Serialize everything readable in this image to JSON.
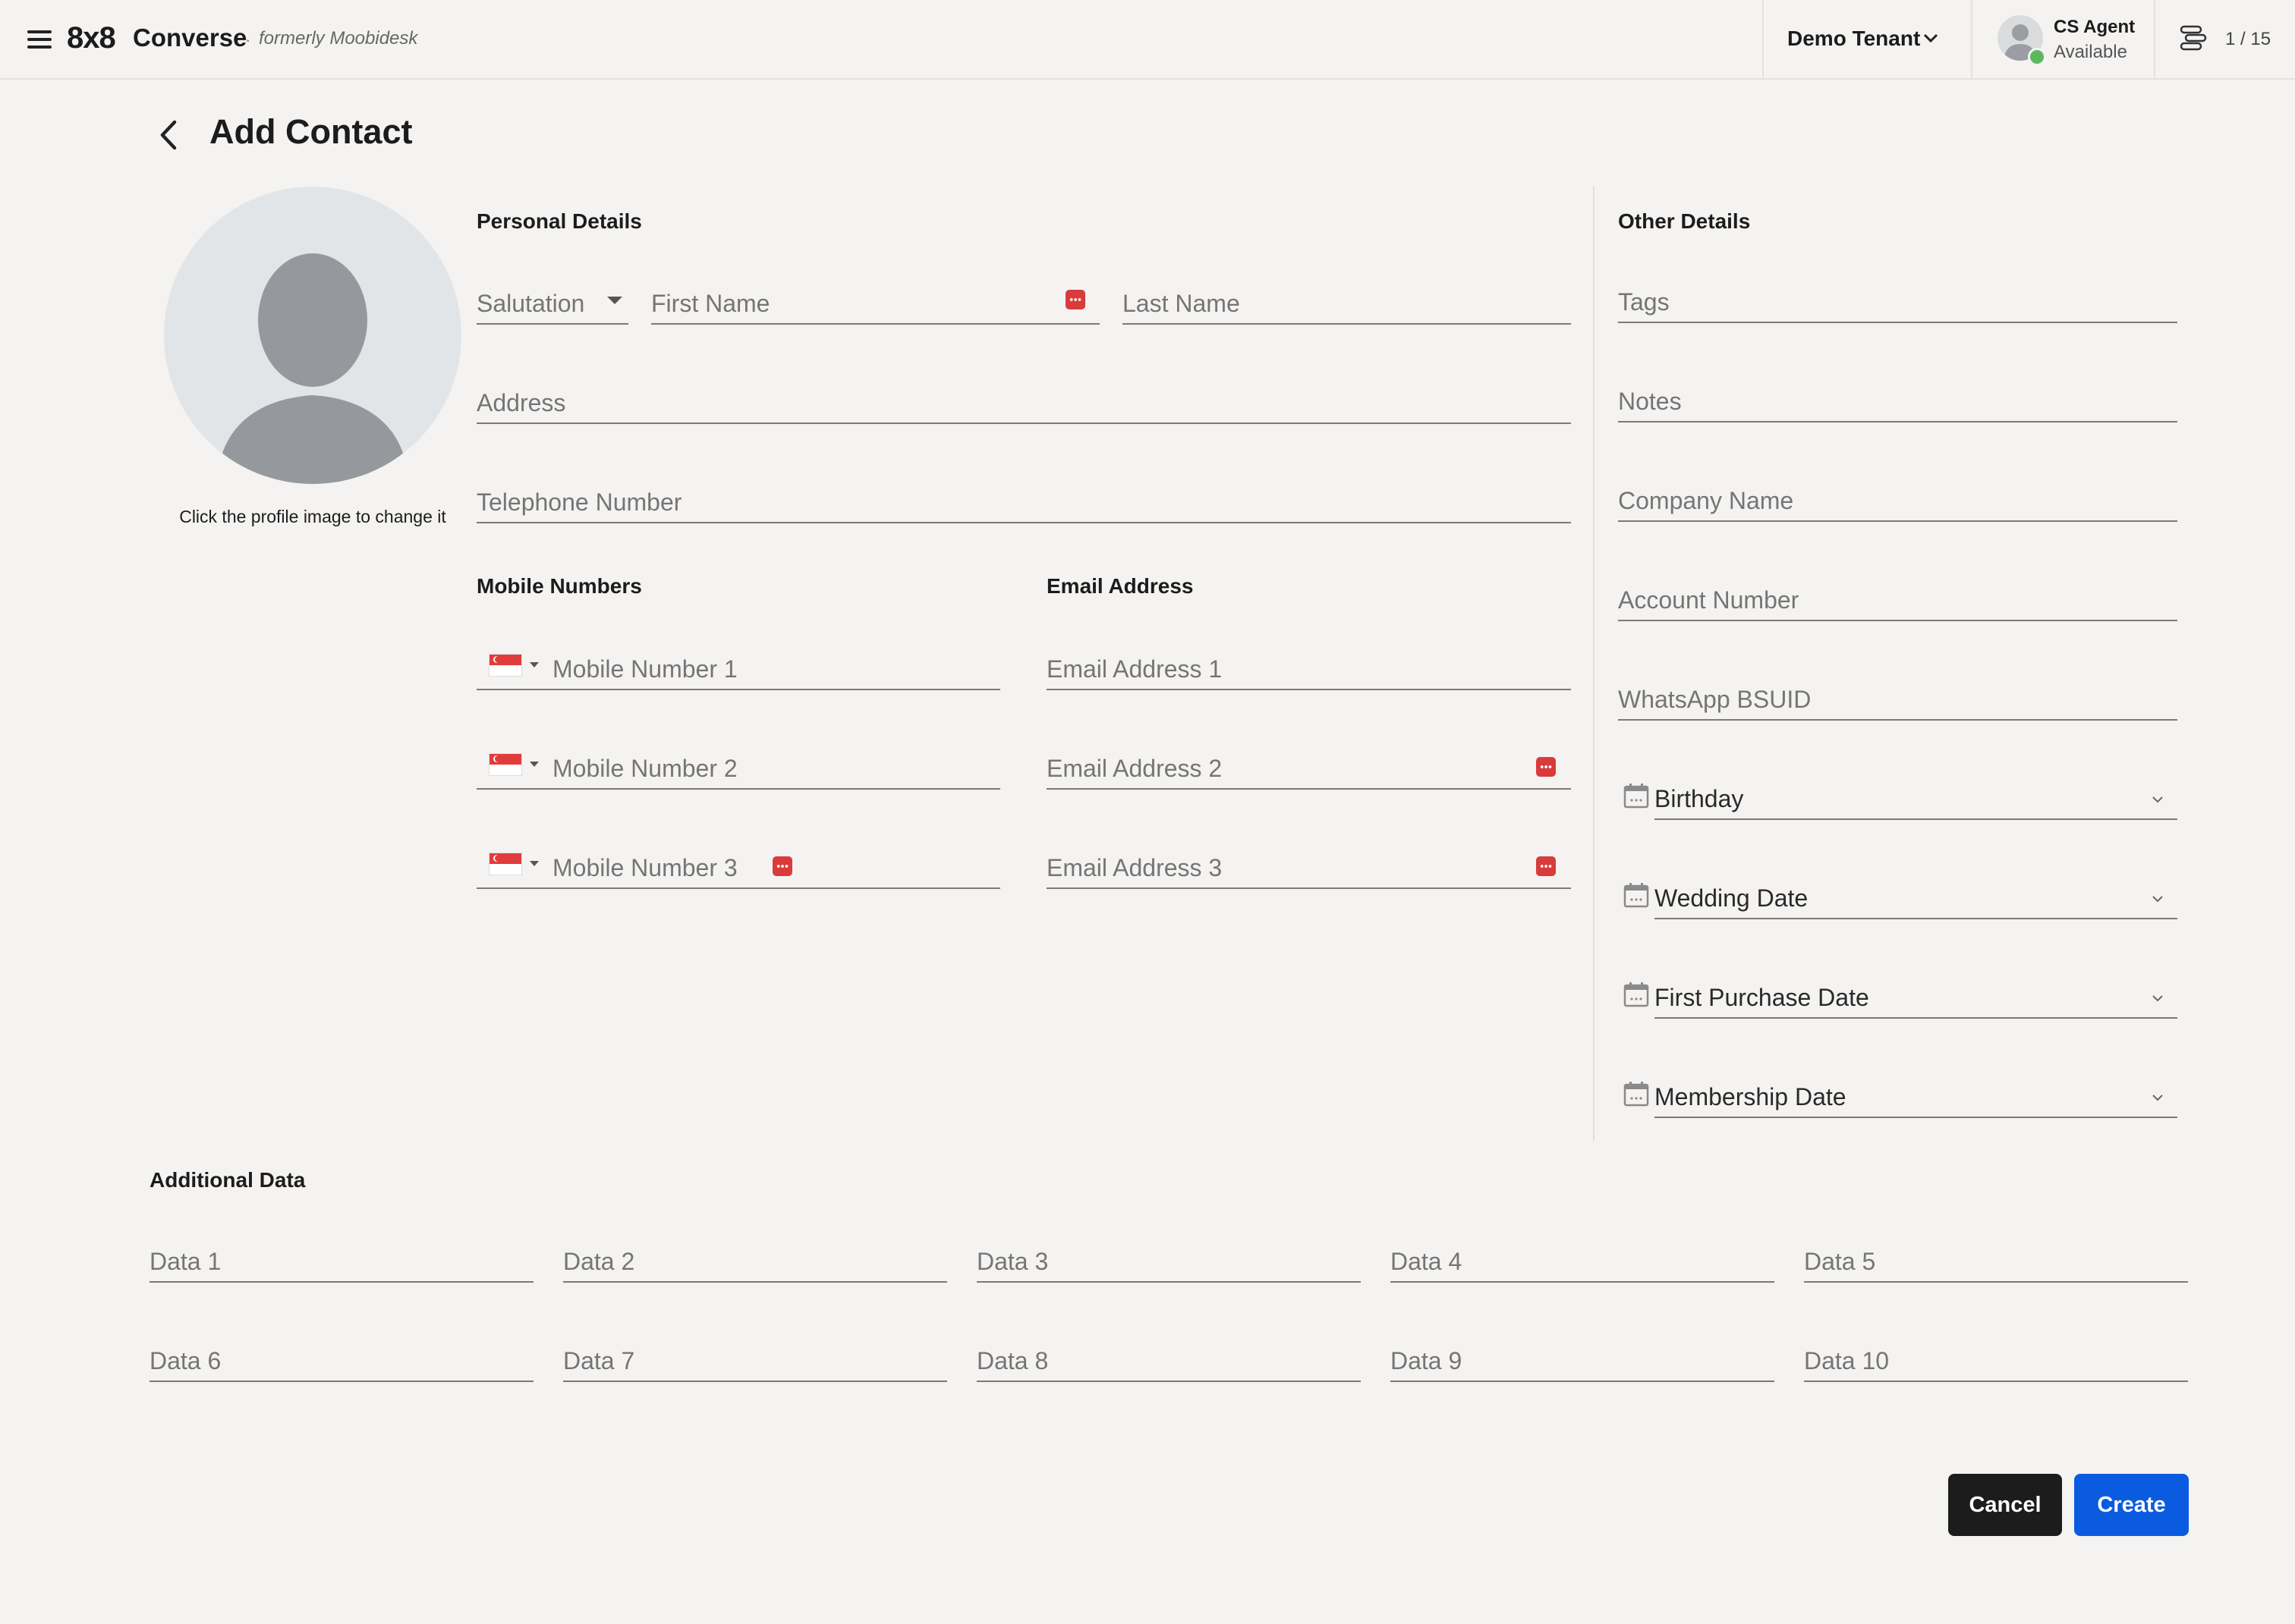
{
  "header": {
    "brand_logo": "8x8",
    "brand_name": "Converse",
    "separator": "·",
    "brand_formerly": "formerly Moobidesk",
    "tenant": "Demo Tenant",
    "agent_name": "CS Agent",
    "agent_status": "Available",
    "queue_count": "1 / 15"
  },
  "page": {
    "title": "Add Contact",
    "avatar_caption": "Click the profile image to change it"
  },
  "personal": {
    "title": "Personal Details",
    "salutation": "Salutation",
    "first_name": "First Name",
    "last_name": "Last Name",
    "address": "Address",
    "telephone": "Telephone Number"
  },
  "mobile": {
    "title": "Mobile Numbers",
    "fields": [
      "Mobile Number 1",
      "Mobile Number 2",
      "Mobile Number 3"
    ]
  },
  "email": {
    "title": "Email Address",
    "fields": [
      "Email Address 1",
      "Email Address 2",
      "Email Address 3"
    ]
  },
  "other": {
    "title": "Other Details",
    "tags": "Tags",
    "notes": "Notes",
    "company": "Company Name",
    "account": "Account Number",
    "whatsapp": "WhatsApp BSUID",
    "dates": [
      "Birthday",
      "Wedding Date",
      "First Purchase Date",
      "Membership Date"
    ]
  },
  "additional": {
    "title": "Additional Data",
    "fields": [
      "Data 1",
      "Data 2",
      "Data 3",
      "Data 4",
      "Data 5",
      "Data 6",
      "Data 7",
      "Data 8",
      "Data 9",
      "Data 10"
    ]
  },
  "actions": {
    "cancel": "Cancel",
    "create": "Create"
  },
  "colors": {
    "primary": "#0b5be1",
    "cancel": "#1c1c1c",
    "status_available": "#5cb85c",
    "password_manager_icon": "#d93b3b",
    "background": "#f4f3f1"
  },
  "icons": [
    "menu-icon",
    "chevron-down-icon",
    "queue-icon",
    "back-arrow-icon",
    "avatar-placeholder-icon",
    "password-manager-icon",
    "sg-flag-icon",
    "calendar-icon"
  ]
}
